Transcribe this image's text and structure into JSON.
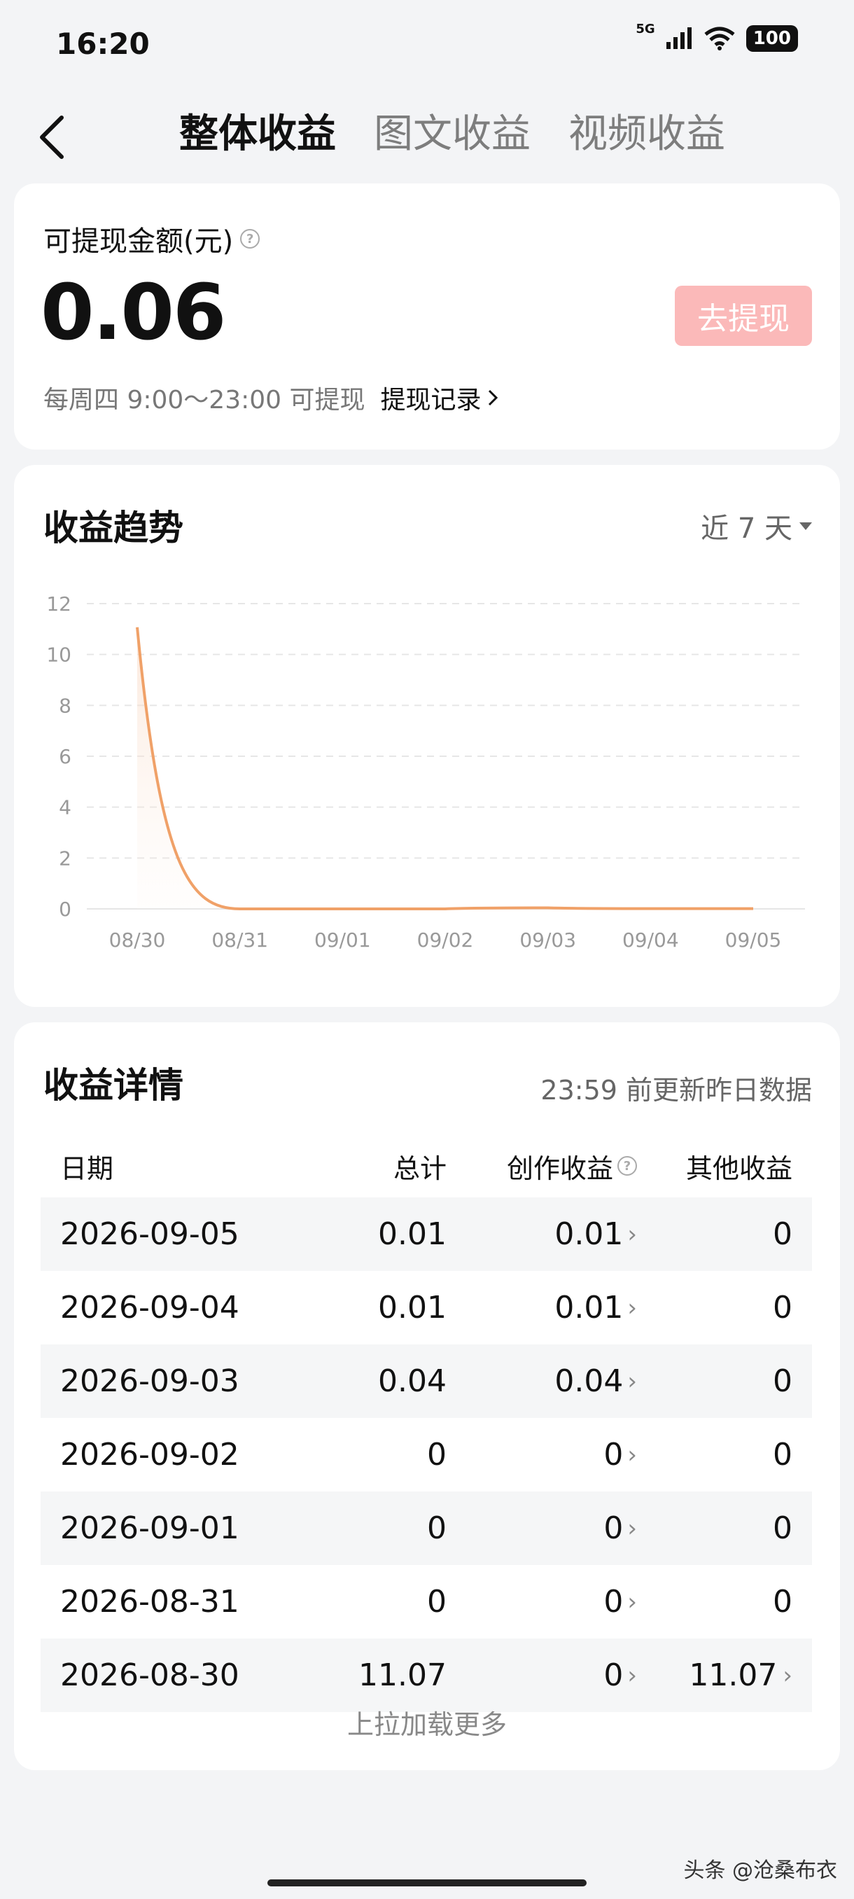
{
  "status_bar": {
    "time": "16:20",
    "network": "5G",
    "battery": "100"
  },
  "header": {
    "tabs": [
      {
        "label": "整体收益",
        "active": true
      },
      {
        "label": "图文收益",
        "active": false
      },
      {
        "label": "视频收益",
        "active": false
      }
    ]
  },
  "withdraw": {
    "label": "可提现金额(元)",
    "amount": "0.06",
    "button": "去提现",
    "schedule": "每周四 9:00～23:00 可提现",
    "record_link": "提现记录"
  },
  "trend": {
    "title": "收益趋势",
    "range": "近 7 天"
  },
  "chart_data": {
    "type": "line",
    "categories": [
      "08/30",
      "08/31",
      "09/01",
      "09/02",
      "09/03",
      "09/04",
      "09/05"
    ],
    "series": [
      {
        "values": [
          11.07,
          0,
          0,
          0,
          0.04,
          0.01,
          0.01
        ]
      }
    ],
    "y_ticks": [
      0,
      2,
      4,
      6,
      8,
      10,
      12
    ],
    "ylim": [
      0,
      12
    ],
    "line_color": "#f0a168",
    "grid": true
  },
  "details": {
    "title": "收益详情",
    "update_note": "23:59 前更新昨日数据",
    "columns": {
      "date": "日期",
      "total": "总计",
      "creation": "创作收益",
      "other": "其他收益"
    },
    "rows": [
      {
        "date": "2026-09-05",
        "total": "0.01",
        "creation": "0.01",
        "other": "0"
      },
      {
        "date": "2026-09-04",
        "total": "0.01",
        "creation": "0.01",
        "other": "0"
      },
      {
        "date": "2026-09-03",
        "total": "0.04",
        "creation": "0.04",
        "other": "0"
      },
      {
        "date": "2026-09-02",
        "total": "0",
        "creation": "0",
        "other": "0"
      },
      {
        "date": "2026-09-01",
        "total": "0",
        "creation": "0",
        "other": "0"
      },
      {
        "date": "2026-08-31",
        "total": "0",
        "creation": "0",
        "other": "0"
      },
      {
        "date": "2026-08-30",
        "total": "11.07",
        "creation": "0",
        "other": "11.07"
      }
    ],
    "load_more": "上拉加载更多"
  },
  "watermark": "头条 @沧桑布衣",
  "colors": {
    "accent_button": "#fbb9b9",
    "chart_line": "#f0a168"
  }
}
